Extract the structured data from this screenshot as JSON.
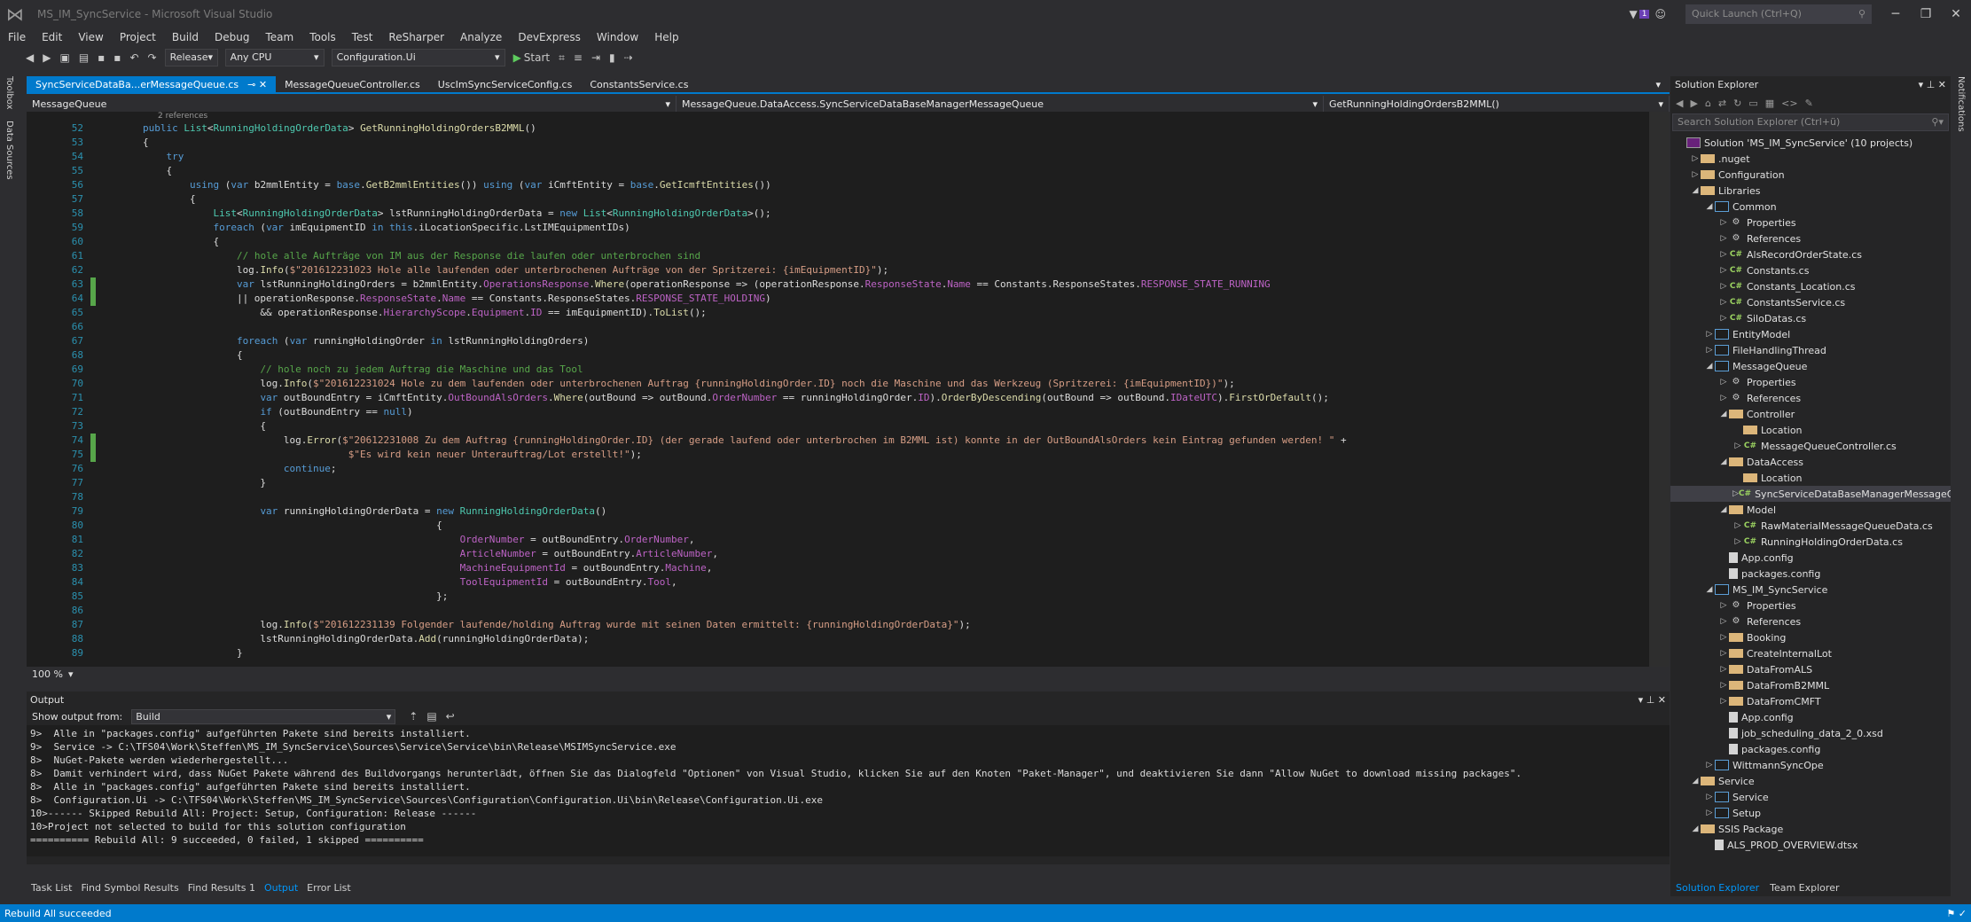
{
  "window": {
    "title": "MS_IM_SyncService - Microsoft Visual Studio",
    "notification_count": "1",
    "quick_launch_placeholder": "Quick Launch (Ctrl+Q)"
  },
  "menu": [
    "File",
    "Edit",
    "View",
    "Project",
    "Build",
    "Debug",
    "Team",
    "Tools",
    "Test",
    "ReSharper",
    "Analyze",
    "DevExpress",
    "Window",
    "Help"
  ],
  "toolbar": {
    "configuration": "Release",
    "platform": "Any CPU",
    "startup_project": "Configuration.Ui",
    "start_label": "Start"
  },
  "left_strip": [
    "Toolbox",
    "Data Sources"
  ],
  "right_strip": [
    "Notifications"
  ],
  "editor": {
    "tabs": [
      "SyncServiceDataBa...erMessageQueue.cs",
      "MessageQueueController.cs",
      "UscImSyncServiceConfig.cs",
      "ConstantsService.cs"
    ],
    "nav_project": "MessageQueue",
    "nav_class": "MessageQueue.DataAccess.SyncServiceDataBaseManagerMessageQueue",
    "nav_member": "GetRunningHoldingOrdersB2MML()",
    "refs_label": "2 references",
    "zoom": "100 %",
    "lines": [
      {
        "n": "52",
        "changed": false,
        "html": "        <span class=\"kw\">public</span> <span class=\"ty\">List</span>&lt;<span class=\"ty\">RunningHoldingOrderData</span>&gt; <span class=\"mt\">GetRunningHoldingOrdersB2MML</span>()"
      },
      {
        "n": "53",
        "changed": false,
        "html": "        {"
      },
      {
        "n": "54",
        "changed": false,
        "html": "            <span class=\"kw\">try</span>"
      },
      {
        "n": "55",
        "changed": false,
        "html": "            {"
      },
      {
        "n": "56",
        "changed": false,
        "html": "                <span class=\"kw\">using</span> (<span class=\"kw\">var</span> b2mmlEntity = <span class=\"kw\">base</span>.<span class=\"mt\">GetB2mmlEntities</span>()) <span class=\"kw\">using</span> (<span class=\"kw\">var</span> iCmftEntity = <span class=\"kw\">base</span>.<span class=\"mt\">GetIcmftEntities</span>())"
      },
      {
        "n": "57",
        "changed": false,
        "html": "                {"
      },
      {
        "n": "58",
        "changed": false,
        "html": "                    <span class=\"ty\">List</span>&lt;<span class=\"ty\">RunningHoldingOrderData</span>&gt; lstRunningHoldingOrderData = <span class=\"kw\">new</span> <span class=\"ty\">List</span>&lt;<span class=\"ty\">RunningHoldingOrderData</span>&gt;();"
      },
      {
        "n": "59",
        "changed": false,
        "html": "                    <span class=\"kw\">foreach</span> (<span class=\"kw\">var</span> imEquipmentID <span class=\"kw\">in</span> <span class=\"kw\">this</span>.iLocationSpecific.LstIMEquipmentIDs)"
      },
      {
        "n": "60",
        "changed": false,
        "html": "                    {"
      },
      {
        "n": "61",
        "changed": false,
        "html": "                        <span class=\"cm\">// hole alle Aufträge von IM aus der Response die laufen oder unterbrochen sind</span>"
      },
      {
        "n": "62",
        "changed": false,
        "html": "                        log.<span class=\"mt\">Info</span>(<span class=\"str\">$\"201612231023 Hole alle laufenden oder unterbrochenen Aufträge von der Spritzerei: {imEquipmentID}\"</span>);"
      },
      {
        "n": "63",
        "changed": true,
        "html": "                        <span class=\"kw\">var</span> lstRunningHoldingOrders = b2mmlEntity.<span class=\"pp\">OperationsResponse</span>.<span class=\"mt\">Where</span>(operationResponse =&gt; (operationResponse.<span class=\"pp\">ResponseState</span>.<span class=\"pp\">Name</span> == Constants.ResponseStates.<span class=\"pp\">RESPONSE_STATE_RUNNING</span>"
      },
      {
        "n": "64",
        "changed": true,
        "html": "                        || operationResponse.<span class=\"pp\">ResponseState</span>.<span class=\"pp\">Name</span> == Constants.ResponseStates.<span class=\"pp\">RESPONSE_STATE_HOLDING</span>)"
      },
      {
        "n": "65",
        "changed": false,
        "html": "                            &amp;&amp; operationResponse.<span class=\"pp\">HierarchyScope</span>.<span class=\"pp\">Equipment</span>.<span class=\"pp\">ID</span> == imEquipmentID).<span class=\"mt\">ToList</span>();"
      },
      {
        "n": "66",
        "changed": false,
        "html": ""
      },
      {
        "n": "67",
        "changed": false,
        "html": "                        <span class=\"kw\">foreach</span> (<span class=\"kw\">var</span> runningHoldingOrder <span class=\"kw\">in</span> lstRunningHoldingOrders)"
      },
      {
        "n": "68",
        "changed": false,
        "html": "                        {"
      },
      {
        "n": "69",
        "changed": false,
        "html": "                            <span class=\"cm\">// hole noch zu jedem Auftrag die Maschine und das Tool</span>"
      },
      {
        "n": "70",
        "changed": false,
        "html": "                            log.<span class=\"mt\">Info</span>(<span class=\"str\">$\"201612231024 Hole zu dem laufenden oder unterbrochenen Auftrag {runningHoldingOrder.ID} noch die Maschine und das Werkzeug (Spritzerei: {imEquipmentID})\"</span>);"
      },
      {
        "n": "71",
        "changed": false,
        "html": "                            <span class=\"kw\">var</span> outBoundEntry = iCmftEntity.<span class=\"pp\">OutBoundAlsOrders</span>.<span class=\"mt\">Where</span>(outBound =&gt; outBound.<span class=\"pp\">OrderNumber</span> == runningHoldingOrder.<span class=\"pp\">ID</span>).<span class=\"mt\">OrderByDescending</span>(outBound =&gt; outBound.<span class=\"pp\">IDateUTC</span>).<span class=\"mt\">FirstOrDefault</span>();"
      },
      {
        "n": "72",
        "changed": false,
        "html": "                            <span class=\"kw\">if</span> (outBoundEntry == <span class=\"kw\">null</span>)"
      },
      {
        "n": "73",
        "changed": false,
        "html": "                            {"
      },
      {
        "n": "74",
        "changed": true,
        "html": "                                log.<span class=\"mt\">Error</span>(<span class=\"str\">$\"20612231008 Zu dem Auftrag {runningHoldingOrder.ID} (der gerade laufend oder unterbrochen im B2MML ist) konnte in der OutBoundAlsOrders kein Eintrag gefunden werden! \"</span> +"
      },
      {
        "n": "75",
        "changed": true,
        "html": "                                           <span class=\"str\">$\"Es wird kein neuer Unterauftrag/Lot erstellt!\"</span>);"
      },
      {
        "n": "76",
        "changed": false,
        "html": "                                <span class=\"kw\">continue</span>;"
      },
      {
        "n": "77",
        "changed": false,
        "html": "                            }"
      },
      {
        "n": "78",
        "changed": false,
        "html": ""
      },
      {
        "n": "79",
        "changed": false,
        "html": "                            <span class=\"kw\">var</span> runningHoldingOrderData = <span class=\"kw\">new</span> <span class=\"ty\">RunningHoldingOrderData</span>()"
      },
      {
        "n": "80",
        "changed": false,
        "html": "                                                          {"
      },
      {
        "n": "81",
        "changed": false,
        "html": "                                                              <span class=\"pp\">OrderNumber</span> = outBoundEntry.<span class=\"pp\">OrderNumber</span>,"
      },
      {
        "n": "82",
        "changed": false,
        "html": "                                                              <span class=\"pp\">ArticleNumber</span> = outBoundEntry.<span class=\"pp\">ArticleNumber</span>,"
      },
      {
        "n": "83",
        "changed": false,
        "html": "                                                              <span class=\"pp\">MachineEquipmentId</span> = outBoundEntry.<span class=\"pp\">Machine</span>,"
      },
      {
        "n": "84",
        "changed": false,
        "html": "                                                              <span class=\"pp\">ToolEquipmentId</span> = outBoundEntry.<span class=\"pp\">Tool</span>,"
      },
      {
        "n": "85",
        "changed": false,
        "html": "                                                          };"
      },
      {
        "n": "86",
        "changed": false,
        "html": ""
      },
      {
        "n": "87",
        "changed": false,
        "html": "                            log.<span class=\"mt\">Info</span>(<span class=\"str\">$\"201612231139 Folgender laufende/holding Auftrag wurde mit seinen Daten ermittelt: {runningHoldingOrderData}\"</span>);"
      },
      {
        "n": "88",
        "changed": false,
        "html": "                            lstRunningHoldingOrderData.<span class=\"mt\">Add</span>(runningHoldingOrderData);"
      },
      {
        "n": "89",
        "changed": false,
        "html": "                        }"
      }
    ]
  },
  "output": {
    "title": "Output",
    "show_from_label": "Show output from:",
    "source": "Build",
    "lines": [
      "9>  Alle in \"packages.config\" aufgeführten Pakete sind bereits installiert.",
      "9>  Service -> C:\\TFS04\\Work\\Steffen\\MS_IM_SyncService\\Sources\\Service\\Service\\bin\\Release\\MSIMSyncService.exe",
      "8>  NuGet-Pakete werden wiederhergestellt...",
      "8>  Damit verhindert wird, dass NuGet Pakete während des Buildvorgangs herunterlädt, öffnen Sie das Dialogfeld \"Optionen\" von Visual Studio, klicken Sie auf den Knoten \"Paket-Manager\", und deaktivieren Sie dann \"Allow NuGet to download missing packages\".",
      "8>  Alle in \"packages.config\" aufgeführten Pakete sind bereits installiert.",
      "8>  Configuration.Ui -> C:\\TFS04\\Work\\Steffen\\MS_IM_SyncService\\Sources\\Configuration\\Configuration.Ui\\bin\\Release\\Configuration.Ui.exe",
      "10>------ Skipped Rebuild All: Project: Setup, Configuration: Release ------",
      "10>Project not selected to build for this solution configuration",
      "========== Rebuild All: 9 succeeded, 0 failed, 1 skipped =========="
    ]
  },
  "bottom_tabs": [
    "Task List",
    "Find Symbol Results",
    "Find Results 1",
    "Output",
    "Error List"
  ],
  "solution_explorer": {
    "title": "Solution Explorer",
    "search_placeholder": "Search Solution Explorer (Ctrl+ü)",
    "nodes": [
      {
        "label": "Solution 'MS_IM_SyncService' (10 projects)",
        "depth": 0,
        "arrow": "",
        "icon": "sln",
        "sel": false
      },
      {
        "label": ".nuget",
        "depth": 1,
        "arrow": "▷",
        "icon": "folder",
        "sel": false
      },
      {
        "label": "Configuration",
        "depth": 1,
        "arrow": "▷",
        "icon": "folder",
        "sel": false
      },
      {
        "label": "Libraries",
        "depth": 1,
        "arrow": "◢",
        "icon": "folder",
        "sel": false
      },
      {
        "label": "Common",
        "depth": 2,
        "arrow": "◢",
        "icon": "proj",
        "sel": false
      },
      {
        "label": "Properties",
        "depth": 3,
        "arrow": "▷",
        "icon": "prop",
        "sel": false
      },
      {
        "label": "References",
        "depth": 3,
        "arrow": "▷",
        "icon": "prop",
        "sel": false
      },
      {
        "label": "AlsRecordOrderState.cs",
        "depth": 3,
        "arrow": "▷",
        "icon": "cs",
        "sel": false
      },
      {
        "label": "Constants.cs",
        "depth": 3,
        "arrow": "▷",
        "icon": "cs",
        "sel": false
      },
      {
        "label": "Constants_Location.cs",
        "depth": 3,
        "arrow": "▷",
        "icon": "cs",
        "sel": false
      },
      {
        "label": "ConstantsService.cs",
        "depth": 3,
        "arrow": "▷",
        "icon": "cs",
        "sel": false
      },
      {
        "label": "SiloDatas.cs",
        "depth": 3,
        "arrow": "▷",
        "icon": "cs",
        "sel": false
      },
      {
        "label": "EntityModel",
        "depth": 2,
        "arrow": "▷",
        "icon": "proj",
        "sel": false
      },
      {
        "label": "FileHandlingThread",
        "depth": 2,
        "arrow": "▷",
        "icon": "proj",
        "sel": false
      },
      {
        "label": "MessageQueue",
        "depth": 2,
        "arrow": "◢",
        "icon": "proj",
        "sel": false
      },
      {
        "label": "Properties",
        "depth": 3,
        "arrow": "▷",
        "icon": "prop",
        "sel": false
      },
      {
        "label": "References",
        "depth": 3,
        "arrow": "▷",
        "icon": "prop",
        "sel": false
      },
      {
        "label": "Controller",
        "depth": 3,
        "arrow": "◢",
        "icon": "folder",
        "sel": false
      },
      {
        "label": "Location",
        "depth": 4,
        "arrow": "",
        "icon": "folder",
        "sel": false
      },
      {
        "label": "MessageQueueController.cs",
        "depth": 4,
        "arrow": "▷",
        "icon": "cs",
        "sel": false
      },
      {
        "label": "DataAccess",
        "depth": 3,
        "arrow": "◢",
        "icon": "folder",
        "sel": false
      },
      {
        "label": "Location",
        "depth": 4,
        "arrow": "",
        "icon": "folder",
        "sel": false
      },
      {
        "label": "SyncServiceDataBaseManagerMessageQueue.cs",
        "depth": 4,
        "arrow": "▷",
        "icon": "cs",
        "sel": true
      },
      {
        "label": "Model",
        "depth": 3,
        "arrow": "◢",
        "icon": "folder",
        "sel": false
      },
      {
        "label": "RawMaterialMessageQueueData.cs",
        "depth": 4,
        "arrow": "▷",
        "icon": "cs",
        "sel": false
      },
      {
        "label": "RunningHoldingOrderData.cs",
        "depth": 4,
        "arrow": "▷",
        "icon": "cs",
        "sel": false
      },
      {
        "label": "App.config",
        "depth": 3,
        "arrow": "",
        "icon": "file",
        "sel": false
      },
      {
        "label": "packages.config",
        "depth": 3,
        "arrow": "",
        "icon": "file",
        "sel": false
      },
      {
        "label": "MS_IM_SyncService",
        "depth": 2,
        "arrow": "◢",
        "icon": "proj",
        "sel": false
      },
      {
        "label": "Properties",
        "depth": 3,
        "arrow": "▷",
        "icon": "prop",
        "sel": false
      },
      {
        "label": "References",
        "depth": 3,
        "arrow": "▷",
        "icon": "prop",
        "sel": false
      },
      {
        "label": "Booking",
        "depth": 3,
        "arrow": "▷",
        "icon": "folder",
        "sel": false
      },
      {
        "label": "CreateInternalLot",
        "depth": 3,
        "arrow": "▷",
        "icon": "folder",
        "sel": false
      },
      {
        "label": "DataFromALS",
        "depth": 3,
        "arrow": "▷",
        "icon": "folder",
        "sel": false
      },
      {
        "label": "DataFromB2MML",
        "depth": 3,
        "arrow": "▷",
        "icon": "folder",
        "sel": false
      },
      {
        "label": "DataFromCMFT",
        "depth": 3,
        "arrow": "▷",
        "icon": "folder",
        "sel": false
      },
      {
        "label": "App.config",
        "depth": 3,
        "arrow": "",
        "icon": "file",
        "sel": false
      },
      {
        "label": "job_scheduling_data_2_0.xsd",
        "depth": 3,
        "arrow": "",
        "icon": "file",
        "sel": false
      },
      {
        "label": "packages.config",
        "depth": 3,
        "arrow": "",
        "icon": "file",
        "sel": false
      },
      {
        "label": "WittmannSyncOpe",
        "depth": 2,
        "arrow": "▷",
        "icon": "proj",
        "sel": false
      },
      {
        "label": "Service",
        "depth": 1,
        "arrow": "◢",
        "icon": "folder",
        "sel": false
      },
      {
        "label": "Service",
        "depth": 2,
        "arrow": "▷",
        "icon": "proj",
        "sel": false
      },
      {
        "label": "Setup",
        "depth": 2,
        "arrow": "▷",
        "icon": "proj",
        "sel": false
      },
      {
        "label": "SSIS Package",
        "depth": 1,
        "arrow": "◢",
        "icon": "folder",
        "sel": false
      },
      {
        "label": "ALS_PROD_OVERVIEW.dtsx",
        "depth": 2,
        "arrow": "",
        "icon": "file",
        "sel": false
      }
    ],
    "tabs": [
      "Solution Explorer",
      "Team Explorer"
    ]
  },
  "status": {
    "text": "Rebuild All succeeded"
  },
  "colors": {
    "accent": "#007acc",
    "background": "#2d2d30",
    "editor": "#1e1e1e"
  }
}
